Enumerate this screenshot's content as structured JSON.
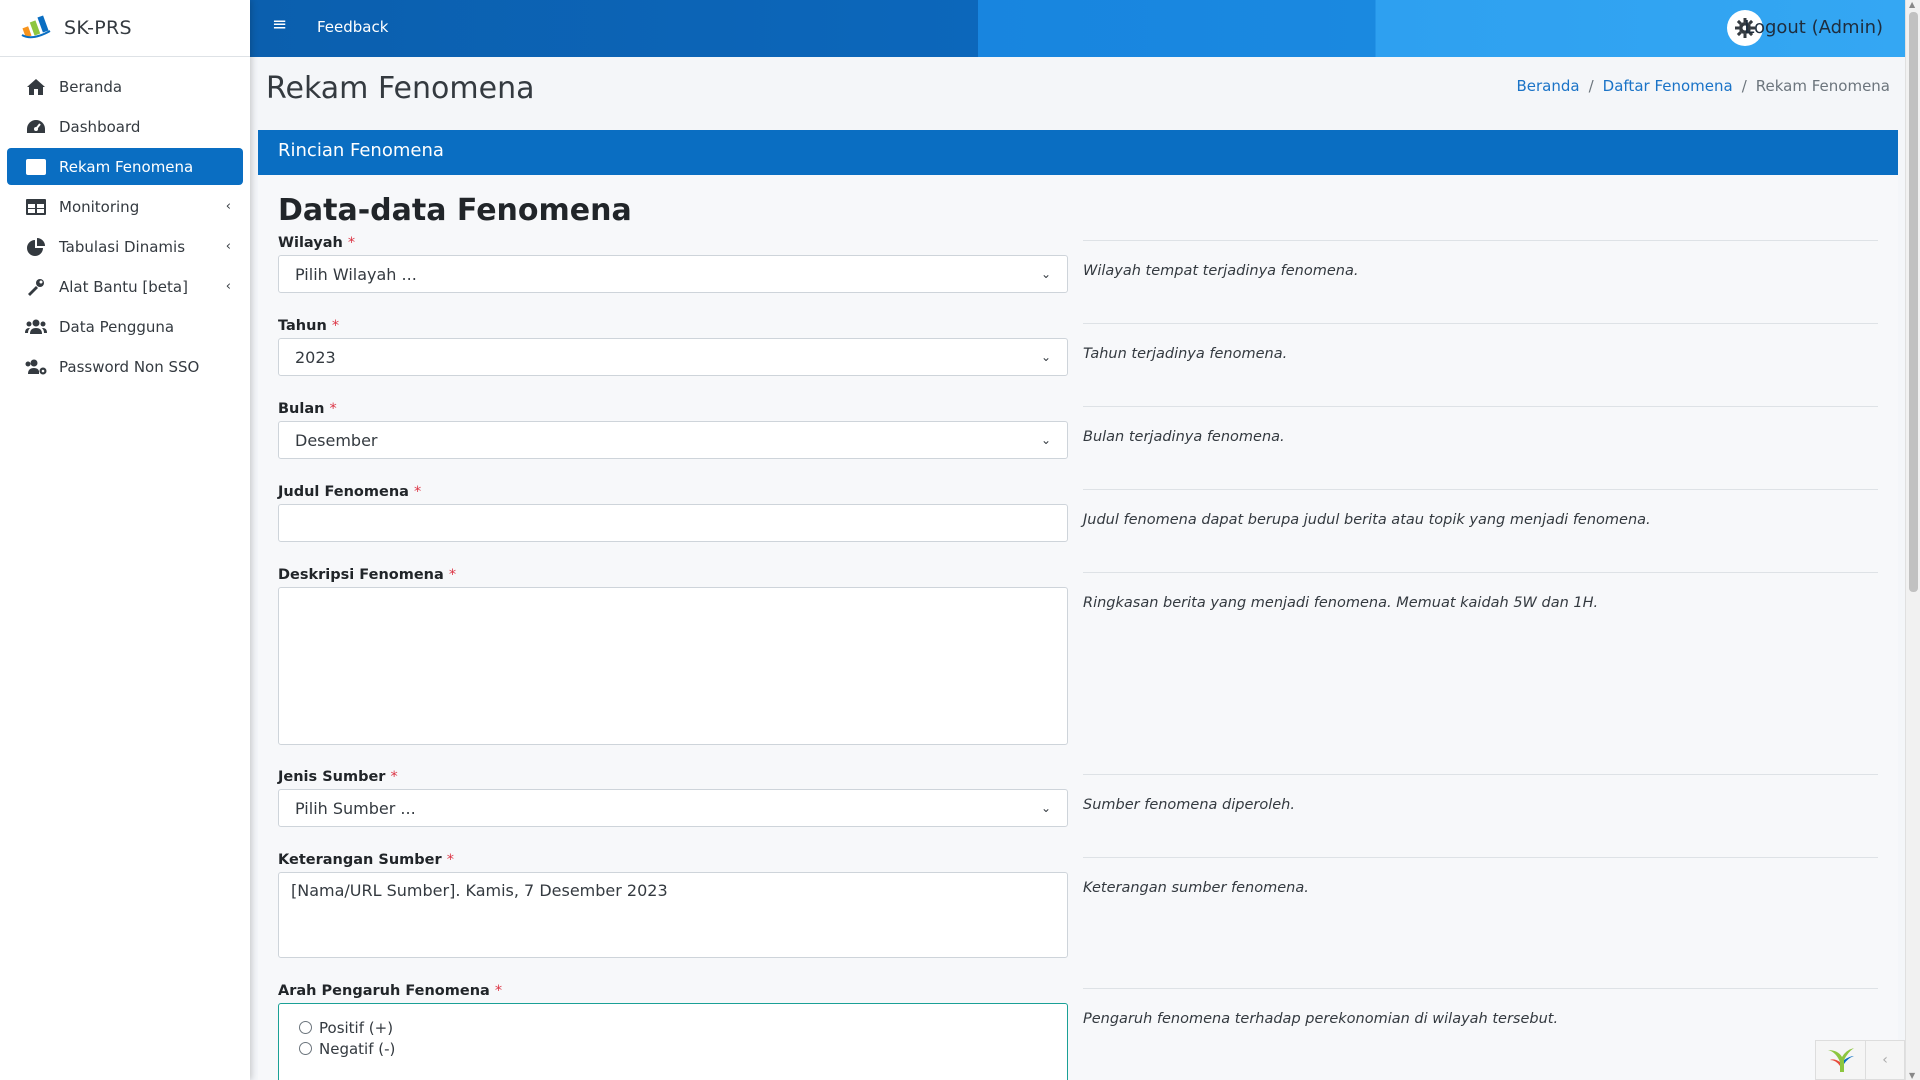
{
  "app": {
    "brand": "SK-PRS"
  },
  "sidebar": {
    "items": [
      {
        "label": "Beranda",
        "icon": "home-icon"
      },
      {
        "label": "Dashboard",
        "icon": "gauge-icon"
      },
      {
        "label": "Rekam Fenomena",
        "icon": "list-icon",
        "active": true
      },
      {
        "label": "Monitoring",
        "icon": "table-icon",
        "chevron": "‹"
      },
      {
        "label": "Tabulasi Dinamis",
        "icon": "pie-icon",
        "chevron": "‹"
      },
      {
        "label": "Alat Bantu [beta]",
        "icon": "tools-icon",
        "chevron": "‹"
      },
      {
        "label": "Data Pengguna",
        "icon": "users-icon"
      },
      {
        "label": "Password Non SSO",
        "icon": "users-cog-icon"
      }
    ]
  },
  "topbar": {
    "menu_glyph": "≡",
    "feedback": "Feedback",
    "logout": "Logout (Admin)",
    "colors": {
      "dark": "#0b5fae",
      "mid": "#1885df",
      "light": "#34a7f3"
    }
  },
  "page": {
    "title": "Rekam Fenomena",
    "breadcrumb": {
      "home": "Beranda",
      "list": "Daftar Fenomena",
      "current": "Rekam Fenomena",
      "sep": "/"
    }
  },
  "card": {
    "header": "Rincian Fenomena",
    "section_title": "Data-data Fenomena",
    "required_mark": "*",
    "fields": {
      "wilayah": {
        "label": "Wilayah",
        "value": "Pilih Wilayah ...",
        "hint": "Wilayah tempat terjadinya fenomena."
      },
      "tahun": {
        "label": "Tahun",
        "value": "2023",
        "hint": "Tahun terjadinya fenomena."
      },
      "bulan": {
        "label": "Bulan",
        "value": "Desember",
        "hint": "Bulan terjadinya fenomena."
      },
      "judul": {
        "label": "Judul Fenomena",
        "value": "",
        "hint": "Judul fenomena dapat berupa judul berita atau topik yang menjadi fenomena."
      },
      "deskripsi": {
        "label": "Deskripsi Fenomena",
        "value": "",
        "hint": "Ringkasan berita yang menjadi fenomena. Memuat kaidah 5W dan 1H."
      },
      "jenis_sumber": {
        "label": "Jenis Sumber",
        "value": "Pilih Sumber ...",
        "hint": "Sumber fenomena diperoleh."
      },
      "keterangan_sumber": {
        "label": "Keterangan Sumber",
        "value": "[Nama/URL Sumber]. Kamis,  7 Desember 2023",
        "hint": "Keterangan sumber fenomena."
      },
      "arah": {
        "label": "Arah Pengaruh Fenomena",
        "options": [
          "Positif (+)",
          "Negatif (-)"
        ],
        "hint": "Pengaruh fenomena terhadap perekonomian di wilayah tersebut."
      }
    }
  },
  "accent_color": "#0a6ec2"
}
